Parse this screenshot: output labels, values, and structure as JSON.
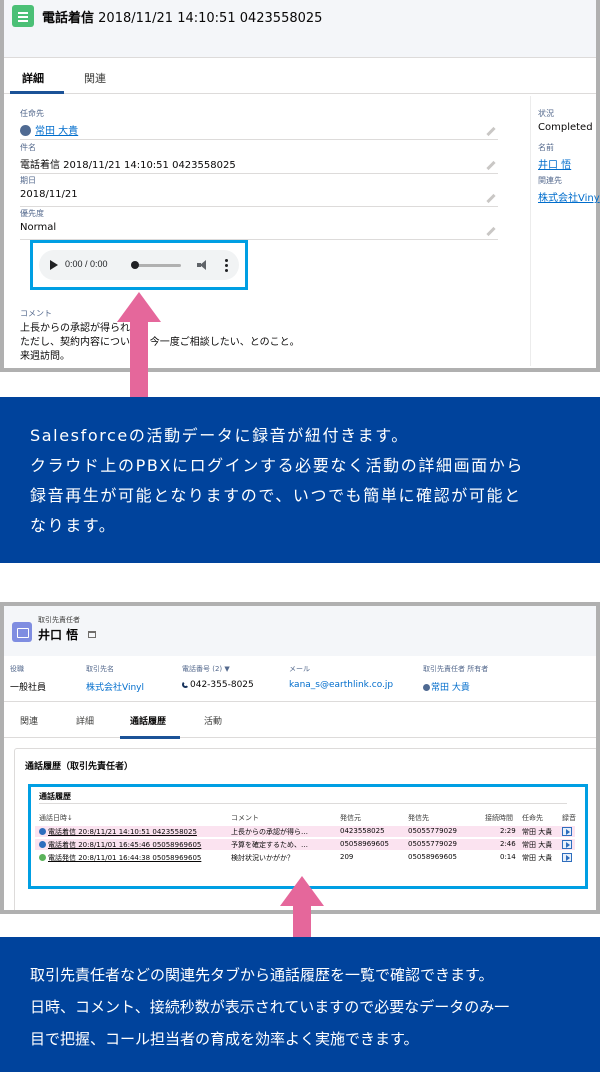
{
  "shot1": {
    "title_type": "電話着信",
    "title_rest": " 2018/11/21 14:10:51 0423558025",
    "tabs": [
      "詳細",
      "関連"
    ],
    "fields": [
      {
        "label": "任命先",
        "value": "常田 大貴",
        "link": true
      },
      {
        "label": "件名",
        "value": "電話着信 2018/11/21 14:10:51 0423558025",
        "link": false
      },
      {
        "label": "期日",
        "value": "2018/11/21",
        "link": false
      },
      {
        "label": "優先度",
        "value": "Normal",
        "link": false
      }
    ],
    "side_fields": [
      {
        "label": "状況",
        "value": "Completed",
        "link": false
      },
      {
        "label": "名前",
        "value": "井口 悟",
        "link": true
      },
      {
        "label": "関連先",
        "value": "株式会社Viny",
        "link": true
      }
    ],
    "audio": {
      "time": "0:00 / 0:00"
    },
    "comment": {
      "label": "コメント",
      "lines": [
        "上長からの承認が得られ",
        "ただし、契約内容について　今一度ご相談したい、とのこと。",
        "来週訪問。"
      ]
    }
  },
  "banner1": {
    "lines": [
      "Salesforceの活動データに録音が紐付きます。",
      "クラウド上のPBXにログインする必要なく活動の詳細画面から",
      "録音再生が可能となりますので、いつでも簡単に確認が可能と",
      "なります。"
    ]
  },
  "shot2": {
    "object_type": "取引先責任者",
    "name": "井口 悟",
    "highlights": [
      {
        "label": "役職",
        "value": "一般社員",
        "link": false
      },
      {
        "label": "取引先名",
        "value": "株式会社Vinyl",
        "link": true
      },
      {
        "label": "電話番号 (2) ▼",
        "value": "042-355-8025",
        "link": false
      },
      {
        "label": "メール",
        "value": "kana_s@earthlink.co.jp",
        "link": true
      },
      {
        "label": "取引先責任者 所有者",
        "value": "常田 大貴",
        "link": true
      }
    ],
    "tabs": [
      "関連",
      "詳細",
      "通話履歴",
      "活動"
    ],
    "card_title": "通話履歴（取引先責任者）",
    "call_log": {
      "title": "通話履歴",
      "headers": [
        "通話日時↓",
        "コメント",
        "発信元",
        "発信先",
        "接続時間",
        "任命先",
        "録音"
      ],
      "rows": [
        {
          "kind": "in",
          "datetime": "電話着信 20:8/11/21 14:10:51 0423558025",
          "comment": "上長からの承認が得ら…",
          "from": "0423558025",
          "to": "05055779029",
          "duration": "2:29",
          "owner": "常田 大貴"
        },
        {
          "kind": "in",
          "datetime": "電話着信 20:8/11/01 16:45:46 05058969605",
          "comment": "予算を確定するため、…",
          "from": "05058969605",
          "to": "05055779029",
          "duration": "2:46",
          "owner": "常田 大貴"
        },
        {
          "kind": "out",
          "datetime": "電話発信 20:8/11/01 16:44:38 05058969605",
          "comment": "検討状況いかがか？",
          "from": "209",
          "to": "05058969605",
          "duration": "0:14",
          "owner": "常田 大貴"
        }
      ]
    }
  },
  "banner2": {
    "lines": [
      "取引先責任者などの関連先タブから通話履歴を一覧で確認できます。",
      "日時、コメント、接続秒数が表示されていますので必要なデータのみ一",
      "目で把握、コール担当者の育成を効率よく実施できます。"
    ]
  },
  "colors": {
    "banner_bg": "#00439c",
    "highlight_box": "#009fe3",
    "arrow": "#e5679b",
    "link": "#006dcc"
  }
}
